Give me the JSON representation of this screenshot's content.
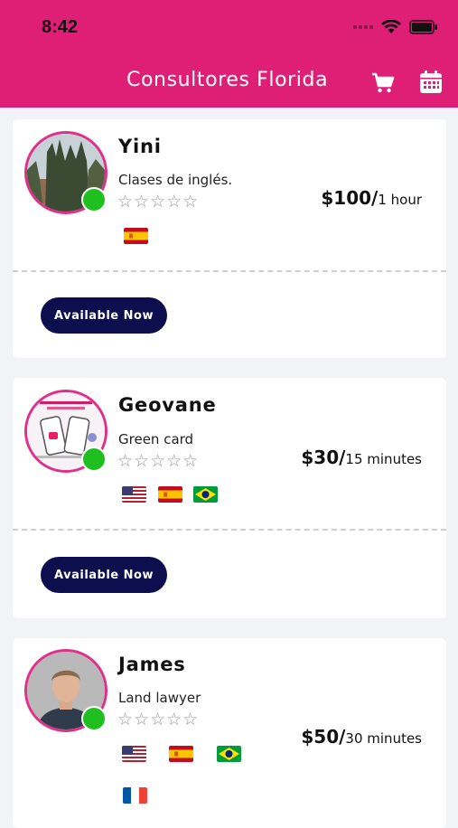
{
  "status_bar": {
    "time": "8:42"
  },
  "header": {
    "title": "Consultores Florida",
    "cart_icon": "cart-icon",
    "calendar_icon": "calendar-icon"
  },
  "colors": {
    "header": "#df1f75",
    "button": "#0d0e4d",
    "online": "#1fbf1f",
    "avatar_ring": "#e0308a"
  },
  "consultants": [
    {
      "name": "Yini",
      "specialty": "Clases de inglés.",
      "rating": "☆☆☆☆☆",
      "price": "$100/",
      "duration": "1 hour",
      "languages": [
        "spanish-flag"
      ],
      "button_label": "Available Now"
    },
    {
      "name": "Geovane",
      "specialty": "Green card",
      "rating": "☆☆☆☆☆",
      "price": "$30/",
      "duration": "15 minutes",
      "languages": [
        "usa-flag",
        "spanish-flag",
        "brazil-flag"
      ],
      "button_label": "Available Now"
    },
    {
      "name": "James",
      "specialty": "Land lawyer",
      "rating": "☆☆☆☆☆",
      "price": "$50/",
      "duration": "30 minutes",
      "languages": [
        "usa-flag",
        "spanish-flag",
        "brazil-flag",
        "france-flag"
      ]
    }
  ]
}
